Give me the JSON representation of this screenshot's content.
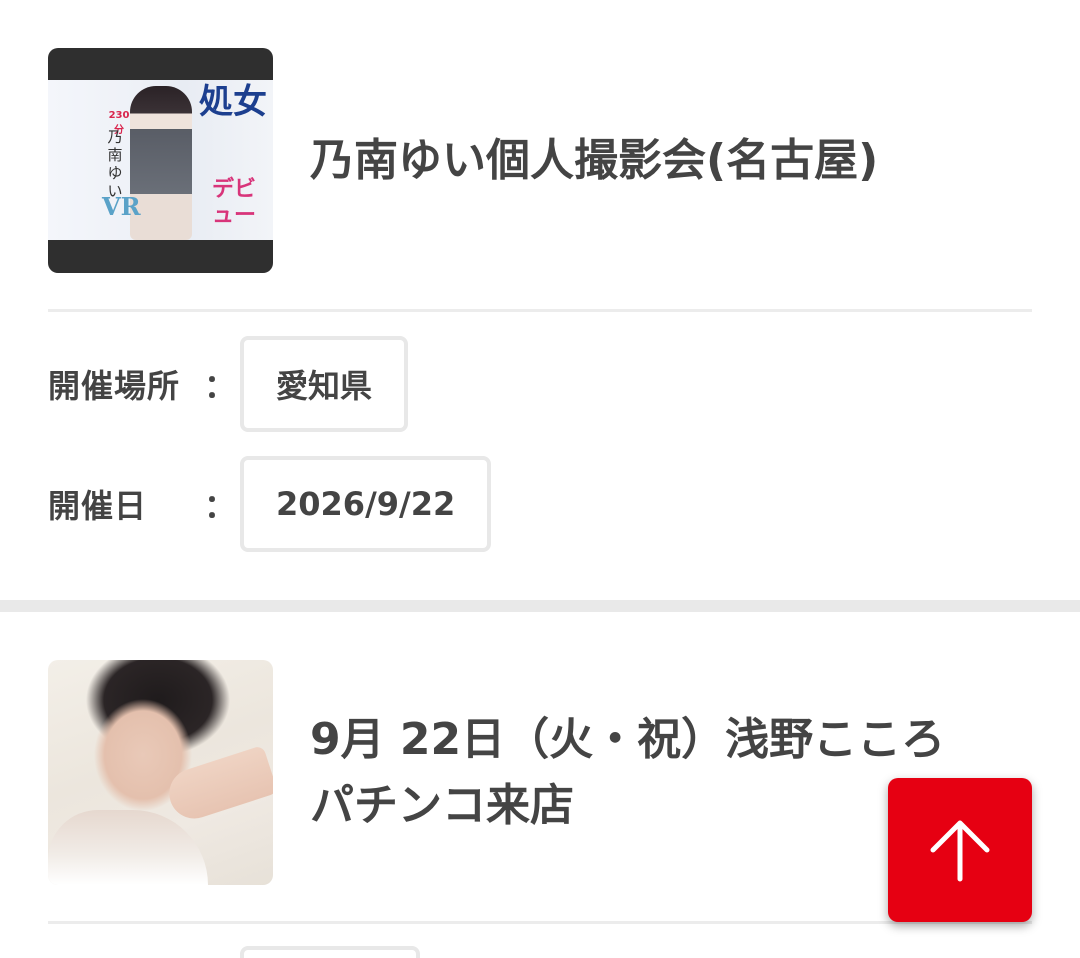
{
  "events": [
    {
      "title": "乃南ゆい個人撮影会(名古屋)",
      "thumbnail": {
        "title_vertical": "処女",
        "subtitle_vertical": "デビュー",
        "name_vertical": "乃南ゆい",
        "minutes": "230分",
        "badge": "VR"
      },
      "place_label": "開催場所",
      "place_colon": "：",
      "place_value": "愛知県",
      "date_label": "開催日",
      "date_colon": "：",
      "date_value": "2026/9/22"
    },
    {
      "title_line1": "9月 22日（火・祝）浅野こころ",
      "title_line2": "パチンコ来店"
    }
  ],
  "back_to_top": {
    "icon": "arrow-up-icon",
    "color": "#e60012"
  },
  "colors": {
    "text": "#444444",
    "divider": "#ececec",
    "box_border": "#e8e8e8",
    "section_gap": "#e9e9e9"
  }
}
